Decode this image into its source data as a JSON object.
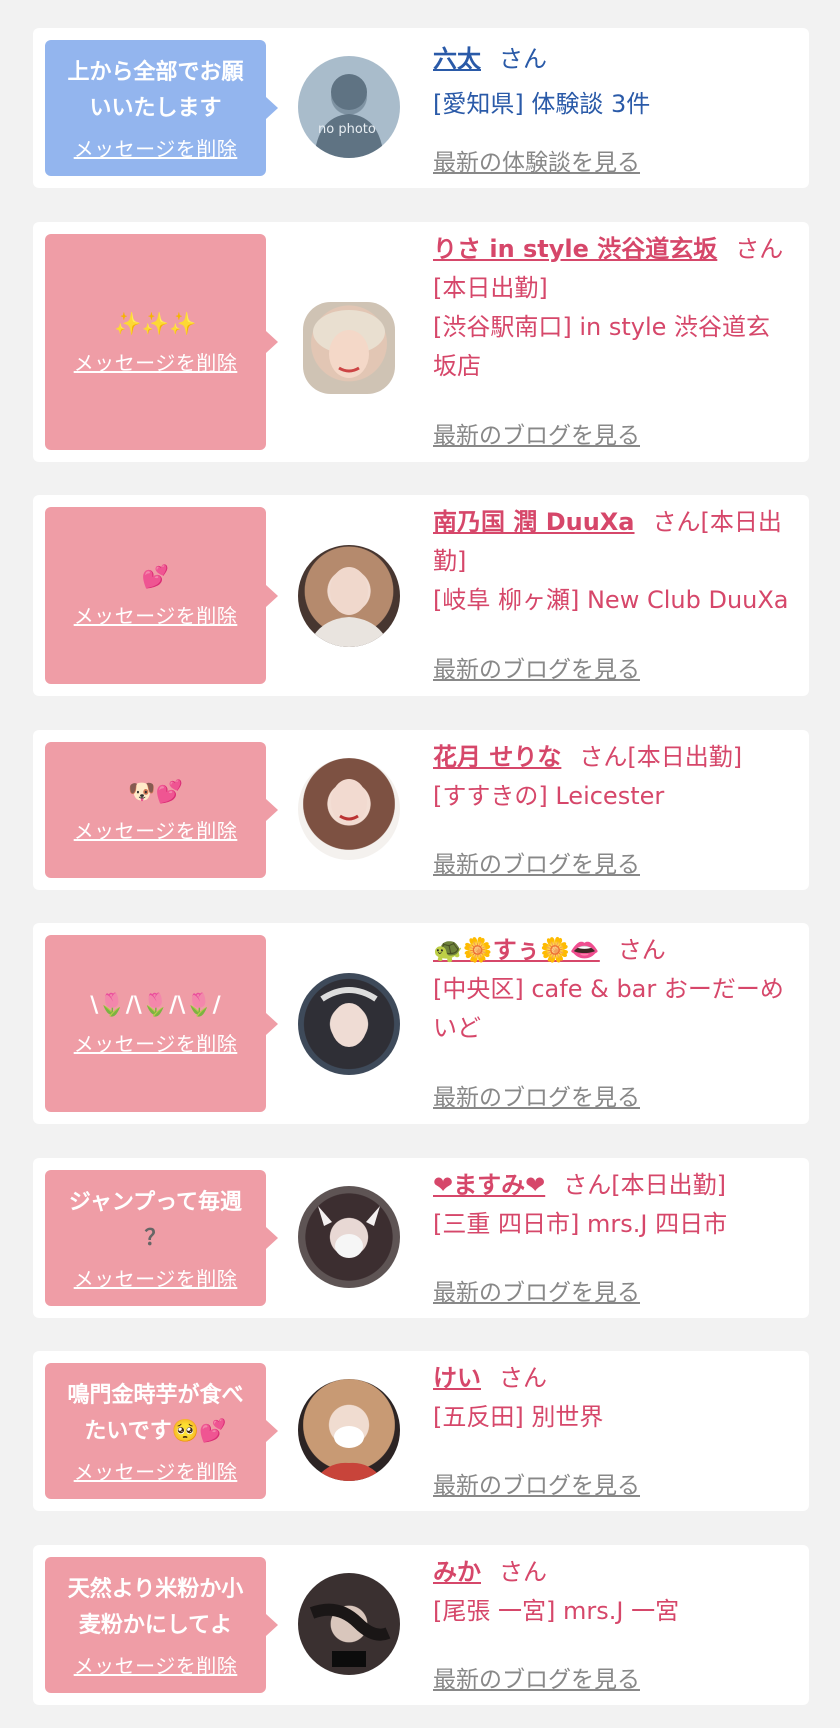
{
  "cards": [
    {
      "bubble_text": [
        "上から全部でお願",
        "いいたします"
      ],
      "delete_label": "メッセージを削除",
      "name": "六太",
      "san": "さん",
      "line1": "[愛知県] 体験談 3件",
      "link": "最新の体験談を見る",
      "avatar_text": "no photo"
    },
    {
      "bubble_text": [
        "✨✨✨"
      ],
      "delete_label": "メッセージを削除",
      "name": "りさ in style 渋谷道玄坂",
      "san": "さん",
      "line1": "[本日出勤]",
      "line2": "[渋谷駅南口] in style 渋谷道玄",
      "line3": "坂店",
      "link": "最新のブログを見る"
    },
    {
      "bubble_text": [
        "💕"
      ],
      "delete_label": "メッセージを削除",
      "name": "南乃国 潤 DuuXa",
      "san": "さん[本日出",
      "line1": "勤]",
      "line2": "[岐阜 柳ヶ瀬] New Club DuuXa",
      "link": "最新のブログを見る"
    },
    {
      "bubble_text": [
        "🐶💕"
      ],
      "delete_label": "メッセージを削除",
      "name": "花月 せりな",
      "san": "さん[本日出勤]",
      "line1": "[すすきの] Leicester",
      "link": "最新のブログを見る"
    },
    {
      "bubble_text": [
        "\\🌷/\\🌷/\\🌷/"
      ],
      "delete_label": "メッセージを削除",
      "name": "🐢🌼すぅ🌼👄",
      "san": "さん",
      "line1": "[中央区] cafe & bar おーだーめ",
      "line2": "いど",
      "link": "最新のブログを見る"
    },
    {
      "bubble_text": [
        "ジャンプって毎週",
        "？"
      ],
      "delete_label": "メッセージを削除",
      "name": "❤ますみ❤",
      "san": "さん[本日出勤]",
      "line1": "[三重 四日市] mrs.J 四日市",
      "link": "最新のブログを見る"
    },
    {
      "bubble_text": [
        "鳴門金時芋が食べ",
        "たいです🥺💕"
      ],
      "delete_label": "メッセージを削除",
      "name": "けい",
      "san": "さん",
      "line1": "[五反田] 別世界",
      "link": "最新のブログを見る"
    },
    {
      "bubble_text": [
        "天然より米粉か小",
        "麦粉かにしてよ"
      ],
      "delete_label": "メッセージを削除",
      "name": "みか",
      "san": "さん",
      "line1": "[尾張 一宮] mrs.J 一宮",
      "link": "最新のブログを見る"
    }
  ],
  "colors": {
    "blue_bubble": "#93b5ee",
    "pink_bubble": "#ef9da6",
    "blue_text": "#2a5aa8",
    "pink_text": "#d6476a",
    "link_gray": "#888888"
  },
  "icons": [
    "avatar-placeholder-icon",
    "avatar-photo"
  ]
}
